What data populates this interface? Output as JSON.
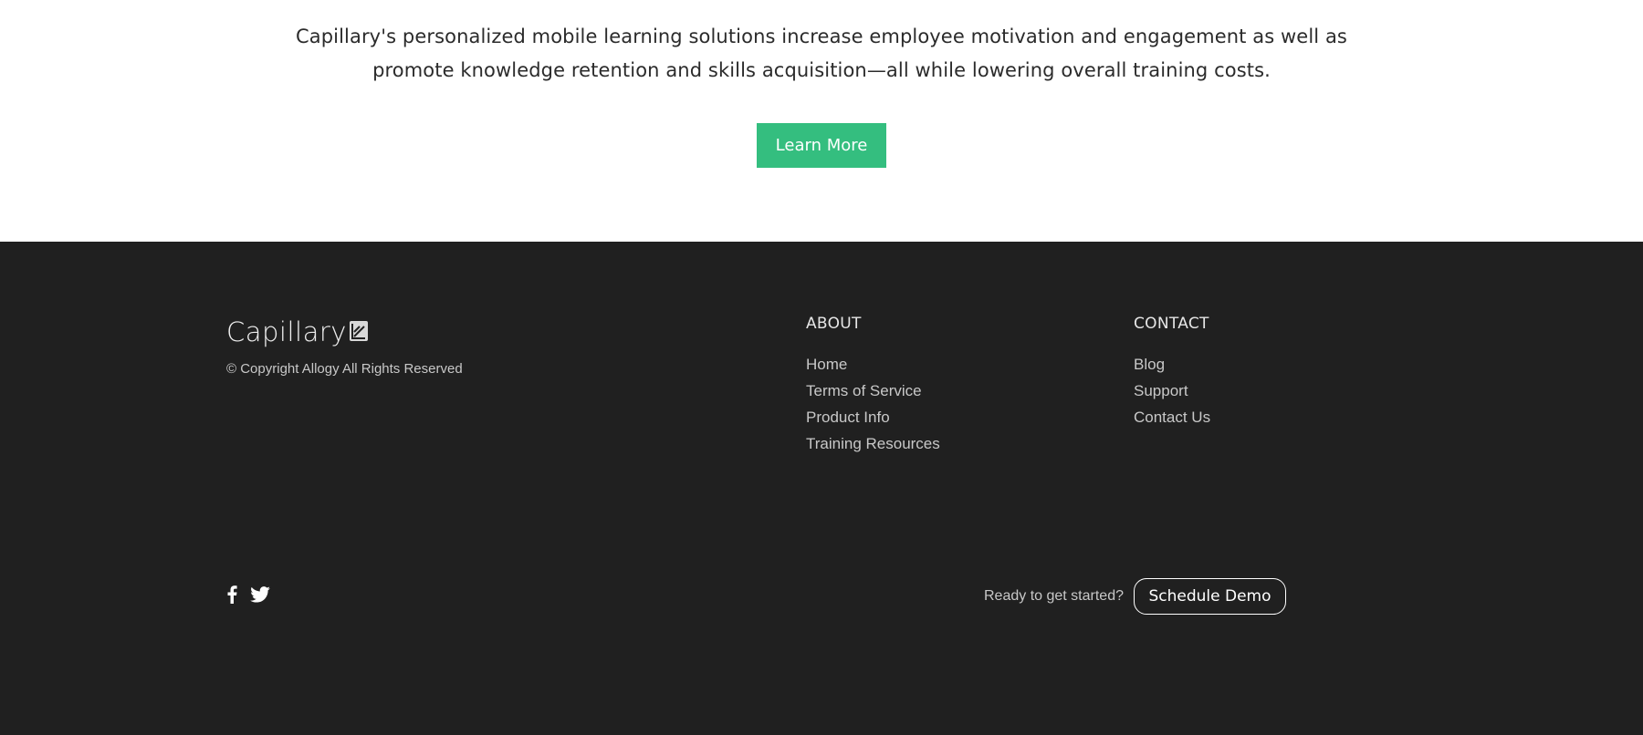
{
  "hero": {
    "text": "Capillary's personalized mobile learning solutions increase employee motivation and engagement as well as promote knowledge retention and skills acquisition—all while lowering overall training costs.",
    "button_label": "Learn More",
    "button_color": "#34be7f"
  },
  "footer": {
    "background": "#202020",
    "logo": {
      "text": "Capillary",
      "icon": "capillary-logo-mark-icon"
    },
    "copyright": "© Copyright Allogy All Rights Reserved",
    "about": {
      "heading": "ABOUT",
      "links": [
        "Home",
        "Terms of Service",
        "Product Info",
        "Training Resources"
      ]
    },
    "contact": {
      "heading": "CONTACT",
      "links": [
        "Blog",
        "Support",
        "Contact Us"
      ]
    },
    "social": [
      "facebook-icon",
      "twitter-icon"
    ],
    "cta_text": "Ready to get started?",
    "cta_button": "Schedule Demo"
  }
}
